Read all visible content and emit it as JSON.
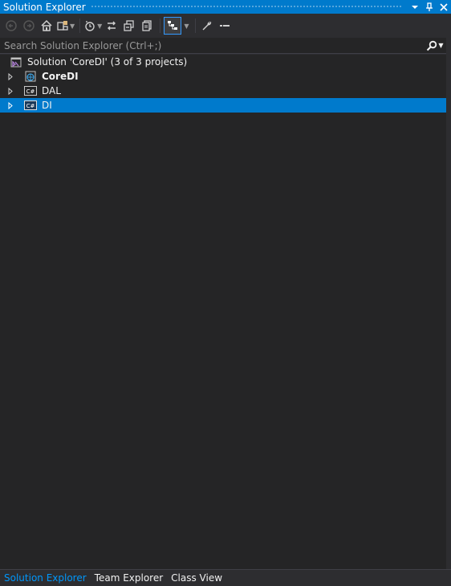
{
  "window": {
    "title": "Solution Explorer",
    "title_buttons": [
      {
        "name": "window-position-menu",
        "icon": "chevron-down-icon"
      },
      {
        "name": "pin-button",
        "icon": "pin-icon"
      },
      {
        "name": "close-button",
        "icon": "close-icon"
      }
    ]
  },
  "toolbar": {
    "buttons": [
      {
        "name": "back-button",
        "icon": "back-arrow-icon"
      },
      {
        "name": "forward-button",
        "icon": "forward-arrow-icon"
      },
      {
        "name": "home-button",
        "icon": "home-icon"
      },
      {
        "name": "switch-views-button",
        "icon": "switch-views-icon"
      },
      {
        "name": "pending-changes-filter-button",
        "icon": "clock-icon"
      },
      {
        "name": "sync-with-active-document-button",
        "icon": "sync-icon"
      },
      {
        "name": "collapse-all-button",
        "icon": "collapse-all-icon"
      },
      {
        "name": "show-all-files-button",
        "icon": "show-all-files-icon"
      },
      {
        "name": "preview-selected-items-button",
        "icon": "preview-icon",
        "active": true
      },
      {
        "name": "properties-button",
        "icon": "wrench-icon"
      },
      {
        "name": "minus-button",
        "icon": "minus-icon"
      }
    ]
  },
  "search": {
    "placeholder": "Search Solution Explorer (Ctrl+;)"
  },
  "tree": {
    "solution": {
      "label": "Solution 'CoreDI' (3 of 3 projects)",
      "icon": "visual-studio-solution-icon"
    },
    "projects": [
      {
        "label": "CoreDI",
        "icon": "web-project-icon",
        "bold": true,
        "selected": false
      },
      {
        "label": "DAL",
        "icon": "csharp-project-icon",
        "bold": false,
        "selected": false
      },
      {
        "label": "DI",
        "icon": "csharp-project-icon",
        "bold": false,
        "selected": true
      }
    ]
  },
  "bottom_tabs": [
    {
      "label": "Solution Explorer",
      "active": true
    },
    {
      "label": "Team Explorer",
      "active": false
    },
    {
      "label": "Class View",
      "active": false
    }
  ],
  "colors": {
    "accent": "#007acc",
    "background": "#252526",
    "chrome": "#2d2d30",
    "active_tab_text": "#0097fb"
  }
}
